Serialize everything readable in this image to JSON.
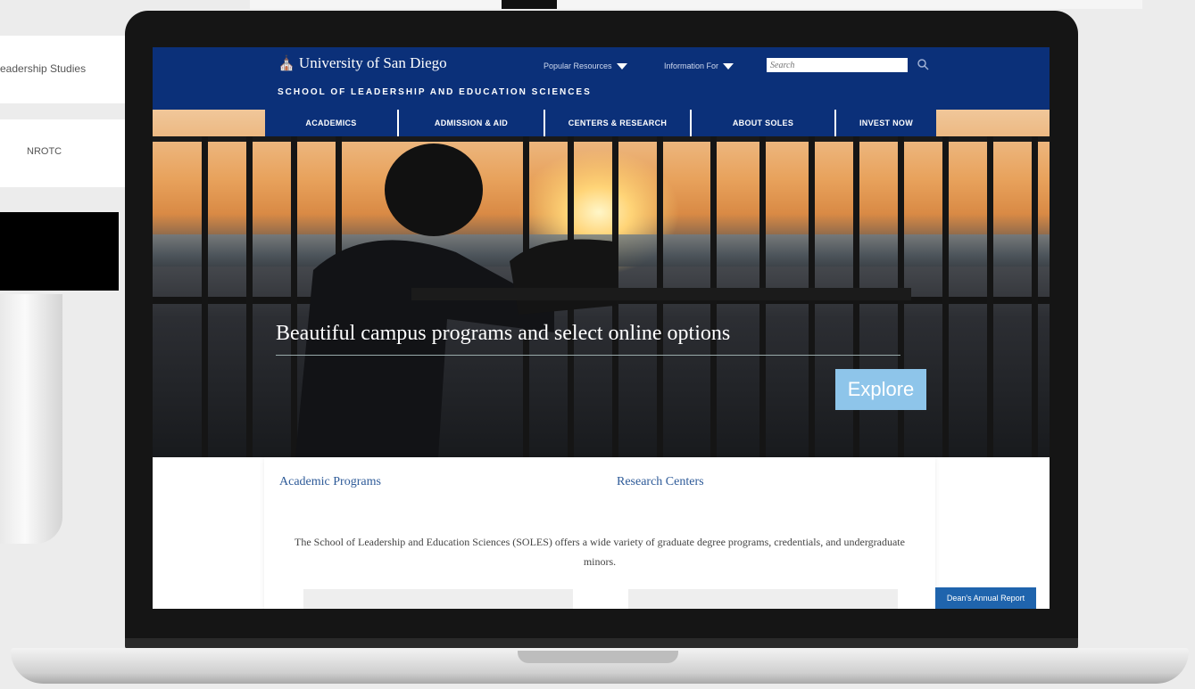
{
  "background": {
    "card_1": "eadership Studies",
    "card_2": "NROTC"
  },
  "site": {
    "logo_text": "University of San Diego",
    "school_name": "SCHOOL OF LEADERSHIP AND EDUCATION SCIENCES",
    "popular_resources": "Popular Resources",
    "information_for": "Information For",
    "search_placeholder": "Search",
    "brand_color": "#0b3079"
  },
  "nav": {
    "items": [
      "ACADEMICS",
      "ADMISSION & AID",
      "CENTERS & RESEARCH",
      "ABOUT SOLES",
      "INVEST NOW"
    ]
  },
  "hero": {
    "headline": "Beautiful campus programs and select online options",
    "cta": "Explore"
  },
  "content": {
    "link_programs": "Academic Programs",
    "link_research": "Research Centers",
    "intro": "The School of Leadership and Education Sciences (SOLES) offers a wide variety of graduate degree programs, credentials, and undergraduate minors.",
    "annual_report": "Dean's Annual Report"
  }
}
